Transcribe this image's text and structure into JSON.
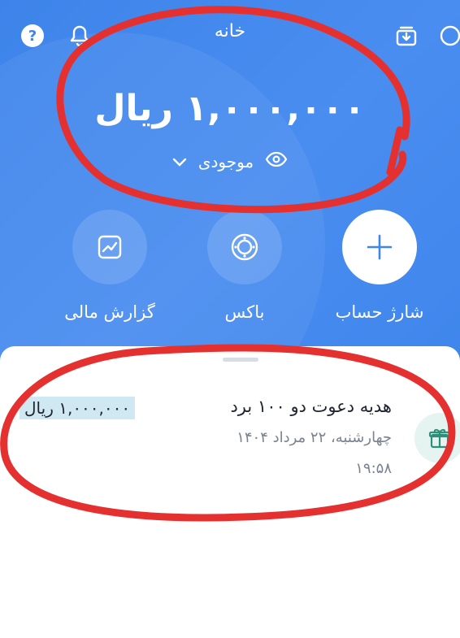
{
  "header": {
    "title": "خانه",
    "balance": "۱,۰۰۰,۰۰۰ ریال",
    "balance_label": "موجودی"
  },
  "actions": [
    {
      "label": "شارژ حساب",
      "icon": "plus-icon"
    },
    {
      "label": "باکس",
      "icon": "box-icon"
    },
    {
      "label": "گزارش مالی",
      "icon": "chart-icon"
    }
  ],
  "transaction": {
    "title": "هدیه دعوت دو ۱۰۰ برد",
    "date": "چهارشنبه، ۲۲ مرداد ۱۴۰۴",
    "time": "۱۹:۵۸",
    "amount": "۱,۰۰۰,۰۰۰ ریال",
    "icon": "gift-icon"
  },
  "colors": {
    "header_blue": "#3f86ec",
    "annotation_red": "#e53030",
    "amount_highlight": "#cfe8f1",
    "gift_green": "#2f8f7a"
  }
}
